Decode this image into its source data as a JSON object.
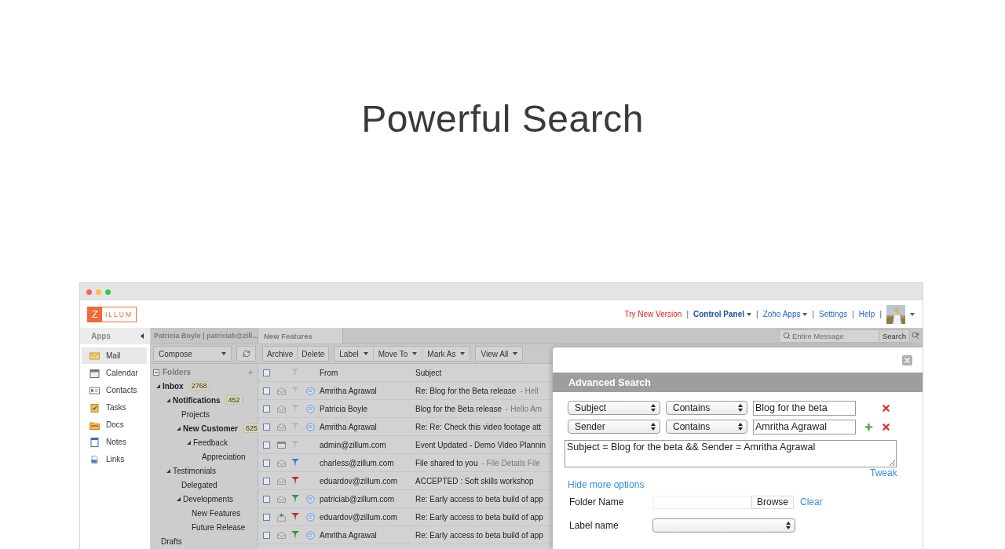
{
  "headline": "Powerful Search",
  "header": {
    "logo": {
      "mark": "Z",
      "name": "ILLUM"
    },
    "links": [
      {
        "label": "Try New Version",
        "kind": "promo",
        "menu": false
      },
      {
        "sep": "|",
        "label": "Control Panel",
        "kind": "strong",
        "menu": true
      },
      {
        "sep": "|",
        "label": "Zoho Apps",
        "kind": "plain",
        "menu": true
      },
      {
        "sep": "|",
        "label": "Settings",
        "kind": "plain",
        "menu": false
      },
      {
        "sep": "|",
        "label": "Help",
        "kind": "plain",
        "menu": false
      }
    ],
    "avatar_sep": "|"
  },
  "apps": {
    "title": "Apps",
    "items": [
      {
        "label": "Mail",
        "selected": true
      },
      {
        "label": "Calendar",
        "selected": false
      },
      {
        "label": "Contacts",
        "selected": false
      },
      {
        "label": "Tasks",
        "selected": false
      },
      {
        "label": "Docs",
        "selected": false
      },
      {
        "label": "Notes",
        "selected": false
      },
      {
        "label": "Links",
        "selected": false
      }
    ]
  },
  "account": "Patricia Boyle | patriciab@zill...",
  "tabs": [
    {
      "label": "New Features",
      "selected": true
    }
  ],
  "search": {
    "placeholder": "Entire Message",
    "button": "Search"
  },
  "toolbar": {
    "compose": "Compose",
    "groups": [
      [
        {
          "label": "Archive",
          "menu": false
        },
        {
          "label": "Delete",
          "menu": false
        }
      ],
      [
        {
          "label": "Label",
          "menu": true
        },
        {
          "label": "Move To",
          "menu": true
        },
        {
          "label": "Mark As",
          "menu": true
        }
      ],
      [
        {
          "label": "View All",
          "menu": true
        }
      ]
    ]
  },
  "folders": {
    "title": "Folders",
    "tree": [
      {
        "label": "Inbox",
        "count": "2768",
        "expanded": true,
        "children": [
          {
            "label": "Notifications",
            "count": "452",
            "expanded": true,
            "children": [
              {
                "label": "Projects"
              },
              {
                "label": "New Customer",
                "count": "625",
                "expanded": true,
                "children": [
                  {
                    "label": "Feedback",
                    "expanded": true,
                    "children": [
                      {
                        "label": "Appreciation"
                      }
                    ]
                  }
                ]
              }
            ]
          },
          {
            "label": "Testimonials",
            "expanded": true,
            "children": [
              {
                "label": "Delegated"
              },
              {
                "label": "Developments",
                "expanded": true,
                "children": [
                  {
                    "label": "New Features"
                  },
                  {
                    "label": "Future Release"
                  }
                ]
              }
            ]
          }
        ]
      },
      {
        "label": "Drafts"
      }
    ]
  },
  "mail": {
    "all_checked": false,
    "columns": [
      "From",
      "Subject"
    ],
    "rows": [
      {
        "checked": false,
        "kind": "envelope",
        "color": "#b9b9b9",
        "thread": true,
        "from": "Amritha Agrawal",
        "subject": "Re: Blog for the Beta release",
        "preview": "- Hell"
      },
      {
        "checked": false,
        "kind": "envelope",
        "color": "#b9b9b9",
        "thread": true,
        "from": "Patricia Boyle",
        "subject": "Blog for the Beta release",
        "preview": "- Hello Am"
      },
      {
        "checked": false,
        "kind": "envelope",
        "color": "#b9b9b9",
        "thread": true,
        "from": "Amritha Agrawal",
        "subject": "Re: Re: Check this video footage att"
      },
      {
        "checked": false,
        "kind": "calendar",
        "color": "#b9b9b9",
        "thread": false,
        "from": "admin@zillum.com",
        "subject": "Event Updated - Demo Video Plannin"
      },
      {
        "checked": false,
        "kind": "envelope",
        "color": "#2a7fd4",
        "thread": false,
        "from": "charless@zillum.com",
        "subject": "File shared to you",
        "preview": "- File Details File"
      },
      {
        "checked": false,
        "kind": "envelope",
        "color": "#c0282d",
        "thread": false,
        "from": "eduardov@zillum.com",
        "subject": "ACCEPTED : Soft skills workshop"
      },
      {
        "checked": false,
        "kind": "envelope",
        "color": "#1e9e2e",
        "thread": true,
        "from": "patriciab@zillum.com",
        "subject": "Re: Early access to beta build of app"
      },
      {
        "checked": false,
        "kind": "reply",
        "color": "#c0282d",
        "thread": true,
        "from": "eduardov@zillum.com",
        "subject": "Re: Early access to beta build of app"
      },
      {
        "checked": false,
        "kind": "envelope",
        "color": "#1e9e2e",
        "thread": true,
        "from": "Amritha Agrawal",
        "subject": "Re: Early access to beta build of app"
      }
    ]
  },
  "advanced_search": {
    "title": "Advanced Search",
    "conditions": [
      {
        "field": "Subject",
        "operator": "Contains",
        "value": "Blog for the beta",
        "can_add": false
      },
      {
        "field": "Sender",
        "operator": "Contains",
        "value": "Amritha Agrawal",
        "can_add": true
      }
    ],
    "query": "Subject = Blog for the beta && Sender = Amritha Agrawal",
    "tweak": "Tweak",
    "toggle": "Hide more options",
    "options": [
      {
        "label": "Folder Name",
        "kind": "browse",
        "button": "Browse",
        "link": "Clear"
      },
      {
        "label": "Label name",
        "kind": "select"
      }
    ]
  }
}
